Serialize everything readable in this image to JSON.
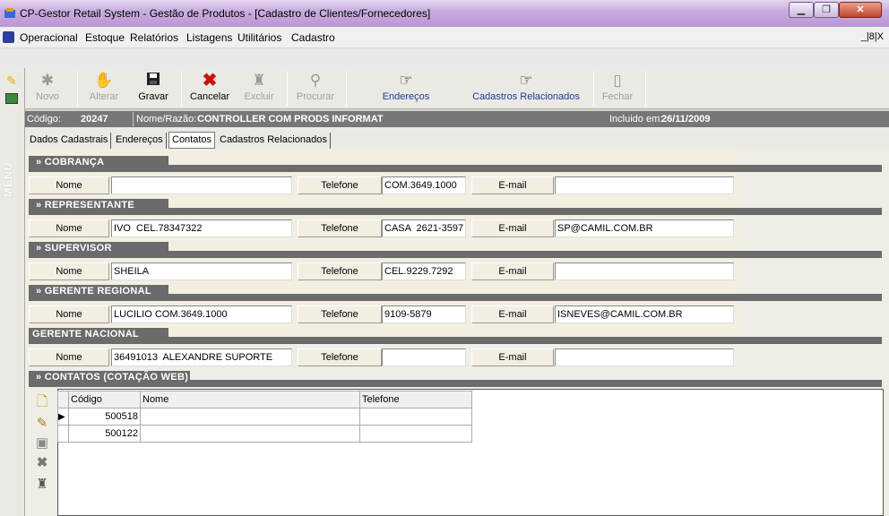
{
  "window": {
    "title": "CP-Gestor Retail System - Gestão de Produtos - [Cadastro de Clientes/Fornecedores]",
    "min_label": "▁",
    "max_label": "❐",
    "close_label": "✕",
    "mdi_controls": "_|8|X"
  },
  "menu": [
    "Operacional",
    "Estoque",
    "Relatórios",
    "Listagens",
    "Utilitários",
    "Cadastro"
  ],
  "sidebar": {
    "vertical_label": "MENU"
  },
  "toolbar": {
    "novo": "Novo",
    "alterar": "Alterar",
    "gravar": "Gravar",
    "cancelar": "Cancelar",
    "excluir": "Excluir",
    "procurar": "Procurar",
    "enderecos": "Endereços",
    "cadastros_rel": "Cadastros Relacionados",
    "fechar": "Fechar"
  },
  "record": {
    "codigo_label": "Código:",
    "codigo": "20247",
    "nome_label": "Nome/Razão:",
    "nome": "CONTROLLER COM PRODS INFORMAT",
    "incluido_label": "Incluido em:",
    "incluido": "26/11/2009"
  },
  "tabs": [
    "Dados Cadastrais",
    "Endereços",
    "Contatos",
    "Cadastros Relacionados"
  ],
  "labels": {
    "nome": "Nome",
    "telefone": "Telefone",
    "email": "E-mail"
  },
  "sections": [
    {
      "title": "» COBRANÇA",
      "nome": "",
      "telefone": "COM.3649.1000",
      "email": ""
    },
    {
      "title": "» REPRESENTANTE",
      "nome": "IVO  CEL.78347322",
      "telefone": "CASA  2621-3597",
      "email": "SP@CAMIL.COM.BR"
    },
    {
      "title": "» SUPERVISOR",
      "nome": "SHEILA",
      "telefone": "CEL.9229.7292",
      "email": ""
    },
    {
      "title": "» GERENTE REGIONAL",
      "nome": "LUCILIO COM.3649.1000",
      "telefone": "9109-5879",
      "email": "ISNEVES@CAMIL.COM.BR"
    },
    {
      "title": "GERENTE NACIONAL",
      "nome": "36491013  ALEXANDRE SUPORTE",
      "telefone": "",
      "email": ""
    }
  ],
  "contatos_web": {
    "title": "» CONTATOS (COTAÇÃO WEB)",
    "columns": [
      "Código",
      "Nome",
      "Telefone"
    ],
    "rows": [
      {
        "codigo": "500518",
        "nome": "",
        "telefone": ""
      },
      {
        "codigo": "500122",
        "nome": "",
        "telefone": ""
      }
    ],
    "current_row_marker": "▶"
  },
  "icons": {
    "novo": "bug-icon",
    "alterar": "hand-icon",
    "gravar": "floppy-icon",
    "cancelar": "x-icon",
    "excluir": "trash-icon",
    "procurar": "magnifier-icon",
    "enderecos": "pointing-hand-icon",
    "cadastros": "pointing-hand-icon",
    "fechar": "door-icon"
  },
  "colors": {
    "section_header": "#6b6b6b",
    "accent_blue": "#1a3a9a",
    "cancel_red": "#d01010"
  }
}
